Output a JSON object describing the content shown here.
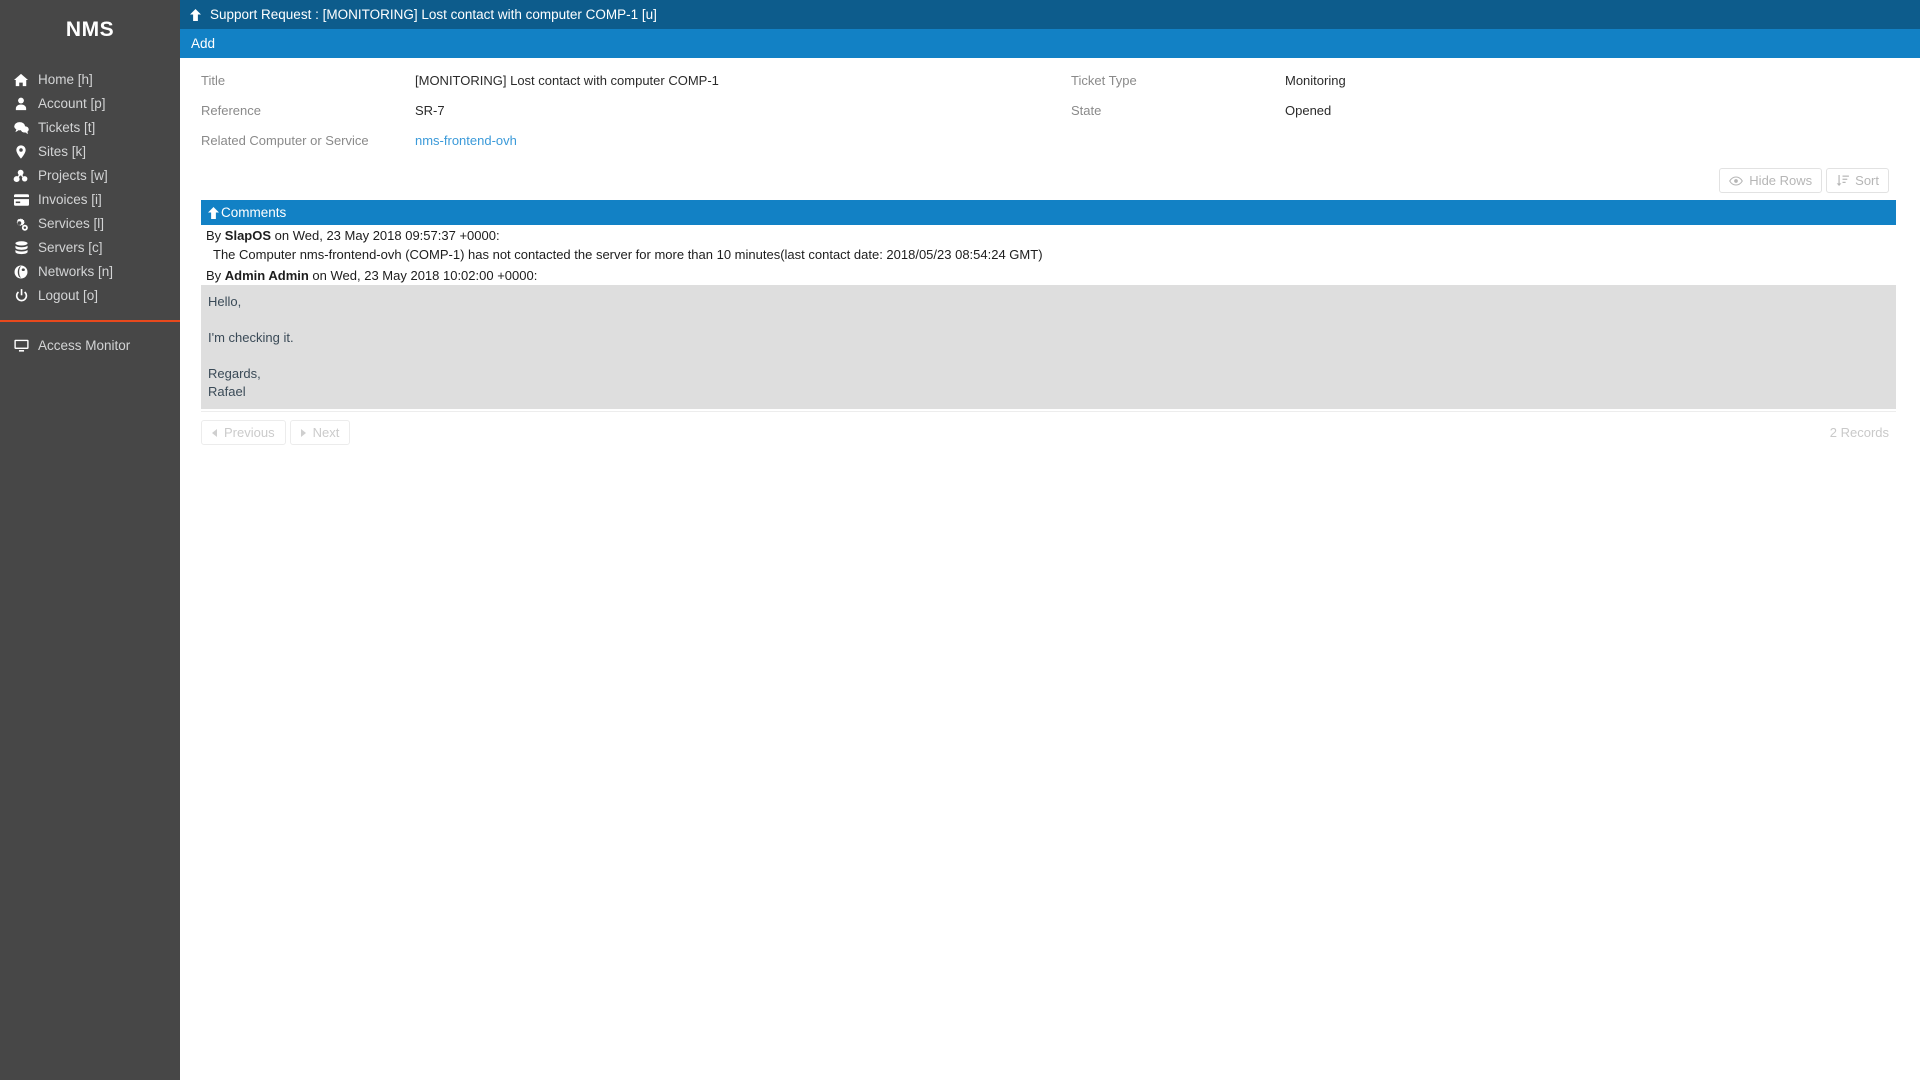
{
  "sidebar": {
    "brand": "NMS",
    "items": [
      {
        "label": "Home [h]",
        "icon": "home-icon"
      },
      {
        "label": "Account [p]",
        "icon": "user-icon"
      },
      {
        "label": "Tickets [t]",
        "icon": "comments-icon"
      },
      {
        "label": "Sites [k]",
        "icon": "map-marker-icon"
      },
      {
        "label": "Projects [w]",
        "icon": "sitemap-icon"
      },
      {
        "label": "Invoices [i]",
        "icon": "credit-card-icon"
      },
      {
        "label": "Services [l]",
        "icon": "cogs-icon"
      },
      {
        "label": "Servers [c]",
        "icon": "database-icon"
      },
      {
        "label": "Networks [n]",
        "icon": "globe-icon"
      },
      {
        "label": "Logout [o]",
        "icon": "power-icon"
      }
    ],
    "footer_items": [
      {
        "label": "Access Monitor",
        "icon": "desktop-icon"
      }
    ],
    "divider_color": "#e8491d"
  },
  "header": {
    "title": "Support Request : [MONITORING] Lost contact with computer COMP-1 [u]",
    "up_icon": "arrow-up-icon",
    "add_label": "Add",
    "bar_color": "#0d5c8c",
    "add_bar_color": "#1281c5"
  },
  "form": {
    "left": [
      {
        "label": "Title",
        "value": "[MONITORING] Lost contact with computer COMP-1",
        "is_link": false
      },
      {
        "label": "Reference",
        "value": "SR-7",
        "is_link": false
      },
      {
        "label": "Related Computer or Service",
        "value": "nms-frontend-ovh",
        "is_link": true
      }
    ],
    "right": [
      {
        "label": "Ticket Type",
        "value": "Monitoring",
        "is_link": false
      },
      {
        "label": "State",
        "value": "Opened",
        "is_link": false
      }
    ],
    "link_color": "#3b9ad9"
  },
  "toolbar": {
    "hide_rows_label": "Hide Rows",
    "hide_rows_icon": "eye-icon",
    "sort_label": "Sort",
    "sort_icon": "sort-amount-icon"
  },
  "comments": {
    "panel_title": "Comments",
    "panel_icon": "arrow-up-icon",
    "entries": [
      {
        "by_prefix": "By ",
        "author": "SlapOS",
        "meta": " on Wed, 23 May 2018 09:57:37 +0000:",
        "text": "The Computer nms-frontend-ovh (COMP-1) has not contacted the server for more than 10 minutes(last contact date: 2018/05/23 08:54:24 GMT)",
        "highlighted": false
      },
      {
        "by_prefix": "By ",
        "author": "Admin Admin",
        "meta": " on Wed, 23 May 2018 10:02:00 +0000:",
        "text": "Hello,\n\nI'm checking it.\n\nRegards,\nRafael",
        "highlighted": true
      }
    ]
  },
  "pagination": {
    "previous_label": "Previous",
    "next_label": "Next",
    "records_label": "2 Records"
  }
}
